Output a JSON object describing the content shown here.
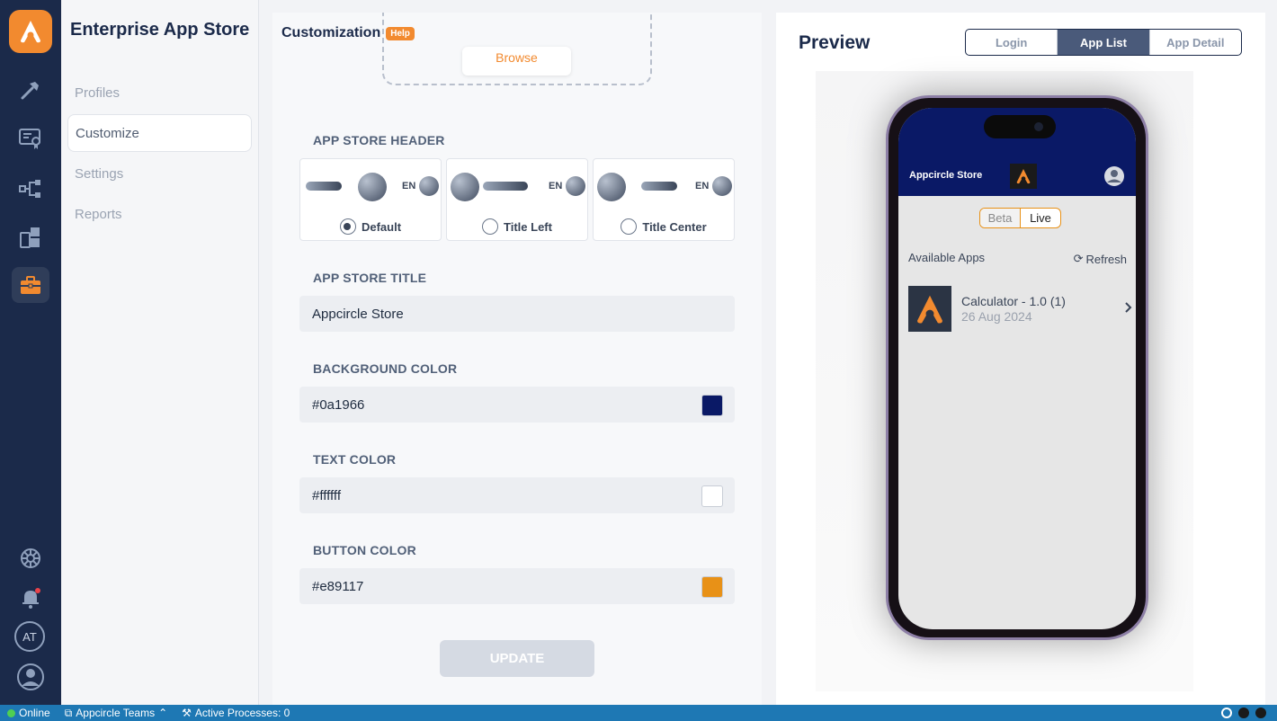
{
  "sidebar": {
    "title": "Enterprise App Store",
    "items": [
      {
        "label": "Profiles",
        "active": false
      },
      {
        "label": "Customize",
        "active": true
      },
      {
        "label": "Settings",
        "active": false
      },
      {
        "label": "Reports",
        "active": false
      }
    ]
  },
  "rail": {
    "icons": [
      "appcircle-logo-icon",
      "hammer-icon",
      "certificate-icon",
      "distribution-icon",
      "publish-icon",
      "enterprise-store-icon"
    ],
    "bottom_icons": [
      "settings-wheel-icon",
      "notification-bell-icon"
    ],
    "avatar_initials": "AT"
  },
  "customization": {
    "title": "Customization",
    "help_badge": "Help",
    "browse_label": "Browse",
    "header_section_label": "APP STORE HEADER",
    "header_en": "EN",
    "header_options": [
      {
        "label": "Default",
        "checked": true
      },
      {
        "label": "Title Left",
        "checked": false
      },
      {
        "label": "Title Center",
        "checked": false
      }
    ],
    "title_section_label": "APP STORE TITLE",
    "title_value": "Appcircle Store",
    "bg_color_label": "BACKGROUND COLOR",
    "bg_color_value": "#0a1966",
    "text_color_label": "TEXT COLOR",
    "text_color_value": "#ffffff",
    "button_color_label": "BUTTON COLOR",
    "button_color_value": "#e89117",
    "update_label": "UPDATE"
  },
  "preview": {
    "title": "Preview",
    "tabs": [
      {
        "label": "Login",
        "active": false
      },
      {
        "label": "App List",
        "active": true
      },
      {
        "label": "App Detail",
        "active": false
      }
    ],
    "phone": {
      "store_name": "Appcircle Store",
      "toggle_beta": "Beta",
      "toggle_live": "Live",
      "available_apps": "Available Apps",
      "refresh": "Refresh",
      "app_name": "Calculator - 1.0 (1)",
      "app_date": "26 Aug 2024"
    }
  },
  "statusbar": {
    "online": "Online",
    "team": "Appcircle Teams",
    "processes": "Active Processes: 0"
  },
  "colors": {
    "brand": "#f28a2f",
    "rail_bg": "#1b2a4a",
    "statusbar_bg": "#1e78b4"
  }
}
